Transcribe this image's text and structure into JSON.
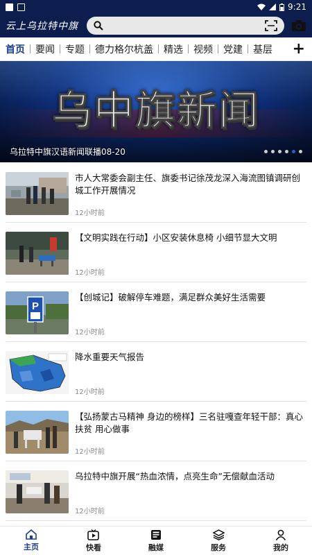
{
  "status_bar": {
    "time": "9:21"
  },
  "header": {
    "app_title": "云上乌拉特中旗",
    "search_icon": "search-icon",
    "scan_icon": "scan-icon",
    "camera_icon": "camera-icon"
  },
  "nav_tabs": [
    {
      "label": "首页",
      "active": true
    },
    {
      "label": "要闻"
    },
    {
      "label": "专题"
    },
    {
      "label": "德力格尔杭盖"
    },
    {
      "label": "精选"
    },
    {
      "label": "视频"
    },
    {
      "label": "党建"
    },
    {
      "label": "基层"
    }
  ],
  "nav_plus": "+",
  "banner": {
    "title": "乌中旗新闻",
    "caption": "乌拉特中旗汉语新闻联播08-20",
    "dots_count": 6,
    "active_dot": 4
  },
  "news": [
    {
      "title": "市人大常委会副主任、旗委书记徐茂龙深入海流图镇调研创城工作开展情况",
      "time": "12小时前"
    },
    {
      "title": "【文明实践在行动】小区安装休息椅  小细节显大文明",
      "time": "12小时前"
    },
    {
      "title": "【创城记】破解停车难题，满足群众美好生活需要",
      "time": "12小时前"
    },
    {
      "title": "降水重要天气报告",
      "time": "12小时前"
    },
    {
      "title": "【弘扬蒙古马精神  身边的榜样】三名驻嘎查年轻干部：真心扶贫  用心做事",
      "time": "12小时前"
    },
    {
      "title": "乌拉特中旗开展“热血浓情，点亮生命”无偿献血活动",
      "time": "12小时前"
    }
  ],
  "bottom_nav": [
    {
      "label": "主页",
      "icon": "home-icon",
      "active": true
    },
    {
      "label": "快看",
      "icon": "video-icon"
    },
    {
      "label": "融媒",
      "icon": "media-icon"
    },
    {
      "label": "服务",
      "icon": "layers-icon"
    },
    {
      "label": "我的",
      "icon": "user-icon"
    }
  ],
  "colors": {
    "header_bg": "#0c1d4e",
    "accent": "#1a3c8e"
  }
}
